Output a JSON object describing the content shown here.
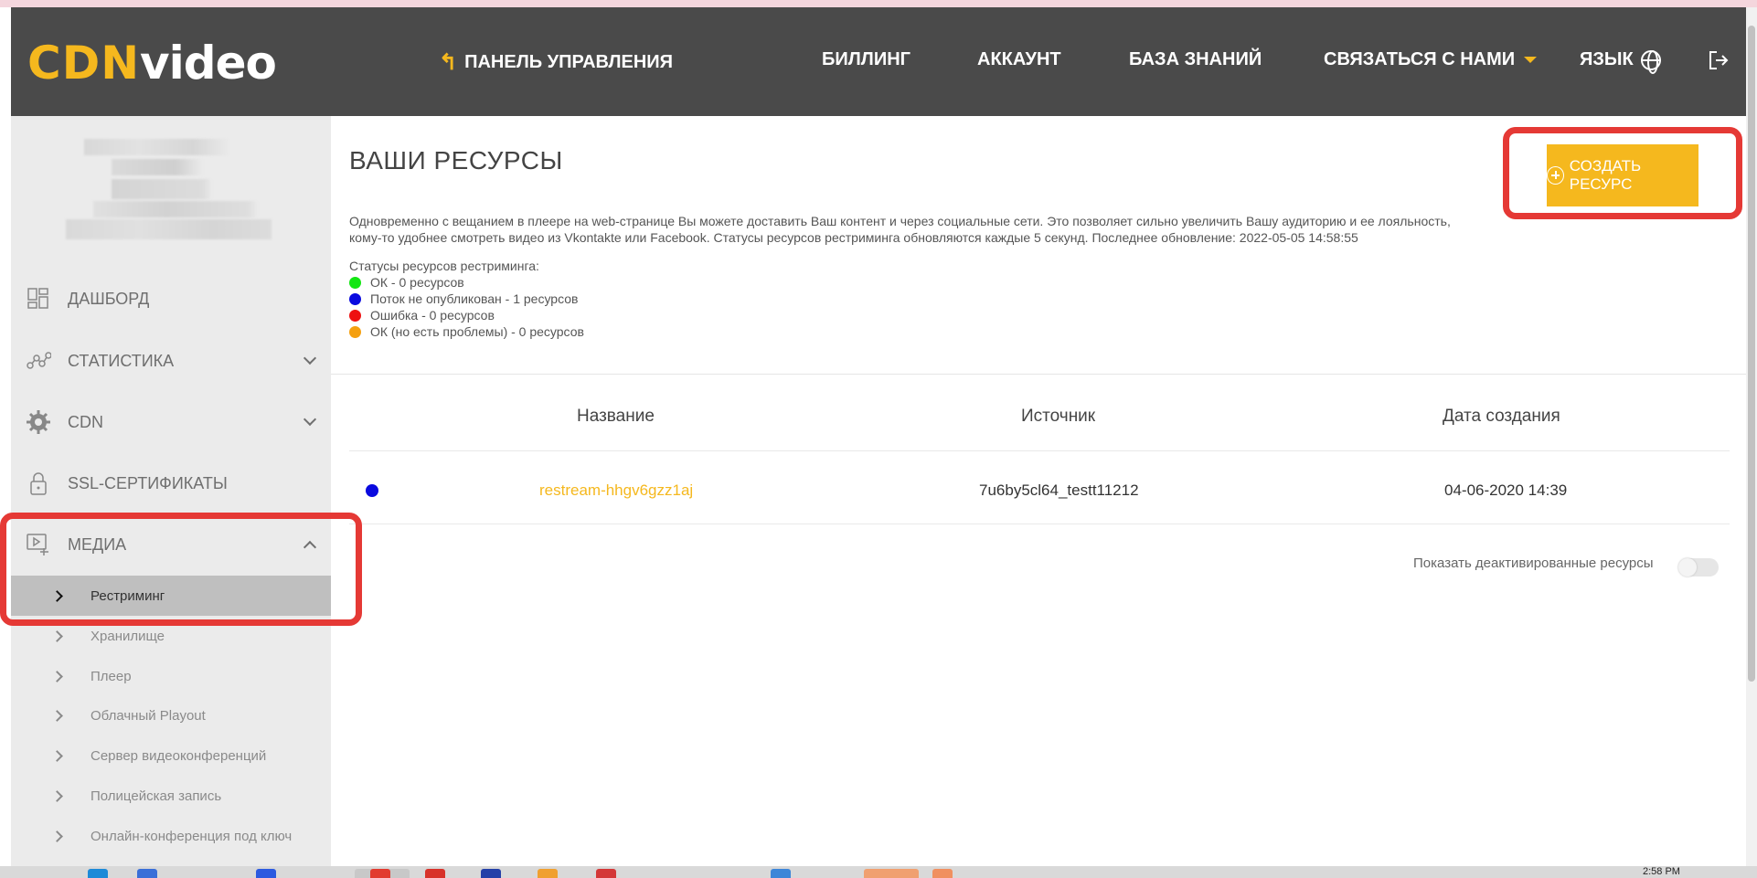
{
  "header": {
    "logo_cdn": "CDN",
    "logo_video": "video",
    "nav": {
      "panel": "ПАНЕЛЬ УПРАВЛЕНИЯ",
      "billing": "БИЛЛИНГ",
      "account": "АККАУНТ",
      "knowledge": "БАЗА ЗНАНИЙ",
      "contact": "СВЯЗАТЬСЯ С НАМИ",
      "language": "ЯЗЫК"
    }
  },
  "sidebar": {
    "items": [
      {
        "label": "ДАШБОРД",
        "icon": "dashboard-icon"
      },
      {
        "label": "СТАТИСТИКА",
        "icon": "statistics-icon"
      },
      {
        "label": "CDN",
        "icon": "gear-icon"
      },
      {
        "label": "SSL-СЕРТИФИКАТЫ",
        "icon": "lock-icon"
      },
      {
        "label": "МЕДИА",
        "icon": "media-icon"
      }
    ],
    "media_sub": [
      {
        "label": "Рестриминг"
      },
      {
        "label": "Хранилище"
      },
      {
        "label": "Плеер"
      },
      {
        "label": "Облачный Playout"
      },
      {
        "label": "Сервер видеоконференций"
      },
      {
        "label": "Полицейская запись"
      },
      {
        "label": "Онлайн-конференция под ключ"
      }
    ]
  },
  "main": {
    "title": "ВАШИ РЕСУРСЫ",
    "create_button": "СОЗДАТЬ РЕСУРС",
    "description_line1": "Одновременно с вещанием в плеере на web-странице Вы можете доставить Ваш контент и через социальные сети. Это позволяет сильно увеличить Вашу аудиторию и ее лояльность,",
    "description_line2": "кому-то удобнее смотреть видео из Vkontakte или Facebook. Статусы ресурсов рестриминга обновляются каждые 5 секунд. Последнее обновление: 2022-05-05 14:58:55",
    "legend_title": "Статусы ресурсов рестриминга:",
    "legend": [
      {
        "label": "ОК - 0 ресурсов",
        "color": "#13e613"
      },
      {
        "label": "Поток не опубликован - 1 ресурсов",
        "color": "#0a0adf"
      },
      {
        "label": "Ошибка - 0 ресурсов",
        "color": "#ee1111"
      },
      {
        "label": "ОК (но есть проблемы) - 0 ресурсов",
        "color": "#f5a010"
      }
    ],
    "table": {
      "headers": [
        "Название",
        "Источник",
        "Дата создания"
      ],
      "rows": [
        {
          "status_color": "#0a0adf",
          "name": "restream-hhgv6gzz1aj",
          "source": "7u6by5cl64_testt11212",
          "created": "04-06-2020 14:39"
        }
      ]
    },
    "show_deactivated": "Показать деактивированные ресурсы"
  },
  "taskbar": {
    "clock": "2:58 PM"
  },
  "colors": {
    "accent": "#f5b81e",
    "header_bg": "#4a4a4a",
    "sidebar_bg": "#ebebeb",
    "highlight": "#e53935"
  }
}
